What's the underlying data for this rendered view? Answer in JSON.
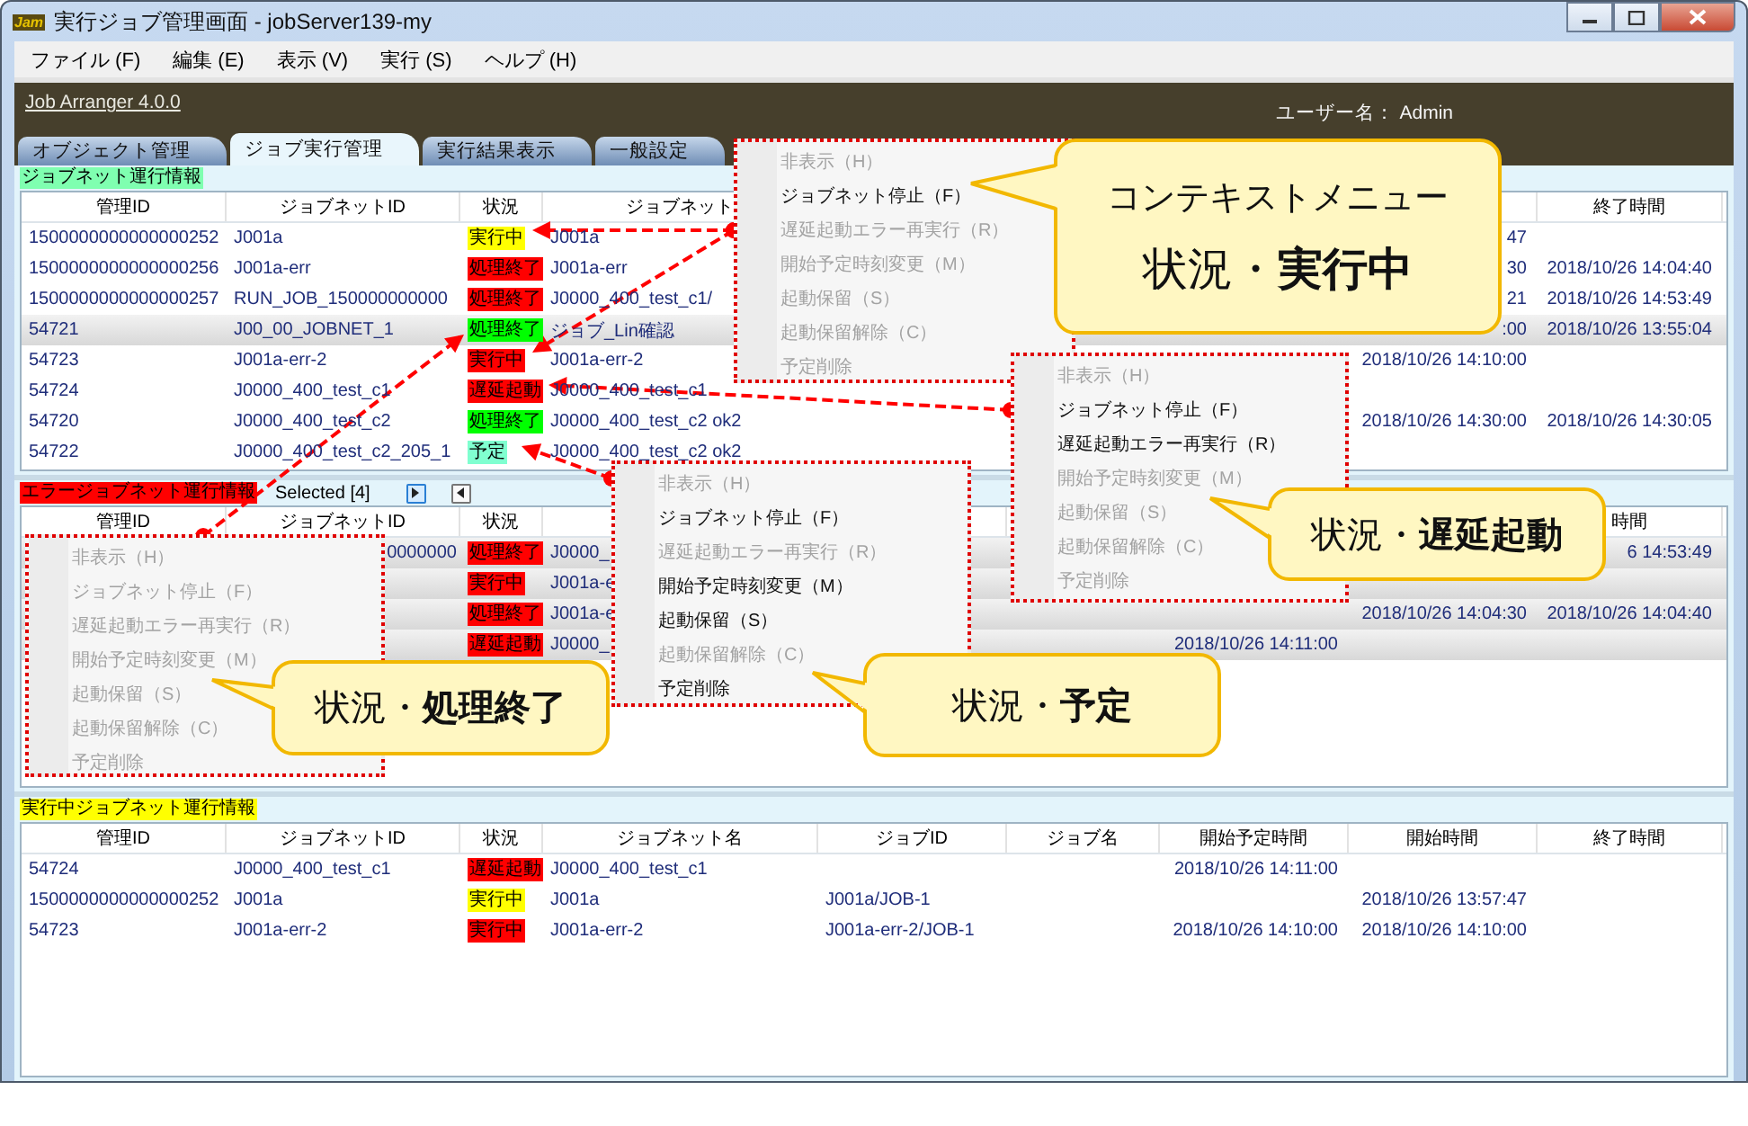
{
  "window": {
    "title": "実行ジョブ管理画面 - jobServer139-my",
    "app_icon": "Jam"
  },
  "menu_bar": [
    "ファイル (F)",
    "編集 (E)",
    "表示 (V)",
    "実行 (S)",
    "ヘルプ (H)"
  ],
  "header": {
    "product": "Job Arranger 4.0.0",
    "user": "ユーザー名： Admin"
  },
  "tabs": [
    {
      "label": "オブジェクト管理",
      "selected": false
    },
    {
      "label": "ジョブ実行管理",
      "selected": true
    },
    {
      "label": "実行結果表示",
      "selected": false
    },
    {
      "label": "一般設定",
      "selected": false
    }
  ],
  "running_panel": {
    "title": "ジョブネット運行情報",
    "table": {
      "columns": {
        "id": "管理ID",
        "jobnet_id": "ジョブネットID",
        "status": "状況",
        "jobnet_name": "ジョブネット",
        "end": "終了時間"
      },
      "rows": [
        {
          "id": "1500000000000000252",
          "jobnet_id": "J001a",
          "status": "実行中",
          "color": "#ffff00",
          "jobnet_name": "J001a",
          "start": "47",
          "selected": false
        },
        {
          "id": "1500000000000000256",
          "jobnet_id": "J001a-err",
          "status": "処理終了",
          "color": "#ff0000",
          "jobnet_name": "J001a-err",
          "start": "30",
          "end": "2018/10/26 14:04:40",
          "selected": false
        },
        {
          "id": "1500000000000000257",
          "jobnet_id": "RUN_JOB_150000000000",
          "status": "処理終了",
          "color": "#ff0000",
          "jobnet_name": "J0000_400_test_c1/",
          "start": "21",
          "end": "2018/10/26 14:53:49",
          "selected": false
        },
        {
          "id": "54721",
          "jobnet_id": "J00_00_JOBNET_1",
          "status": "処理終了",
          "color": "#00ff00",
          "jobnet_name": "ジョブ_Lin確認",
          "start": ":00",
          "end": "2018/10/26 13:55:04",
          "selected": true
        },
        {
          "id": "54723",
          "jobnet_id": "J001a-err-2",
          "status": "実行中",
          "color": "#ff0000",
          "jobnet_name": "J001a-err-2",
          "start": "2018/10/26 14:10:00",
          "selected": false
        },
        {
          "id": "54724",
          "jobnet_id": "J0000_400_test_c1",
          "status": "遅延起動",
          "color": "#ff0000",
          "jobnet_name": "J0000_400_test_c1",
          "selected": false
        },
        {
          "id": "54720",
          "jobnet_id": "J0000_400_test_c2",
          "status": "処理終了",
          "color": "#00ff00",
          "jobnet_name": "J0000_400_test_c2 ok2",
          "start": "2018/10/26 14:30:00",
          "end": "2018/10/26 14:30:05",
          "selected": false
        },
        {
          "id": "54722",
          "jobnet_id": "J0000_400_test_c2_205_1",
          "status": "予定",
          "color": "#80ffd0",
          "jobnet_name": "J0000_400_test_c2 ok2",
          "selected": false
        }
      ]
    }
  },
  "error_panel": {
    "title": "エラージョブネット運行情報",
    "selection": "Selected [4]",
    "table": {
      "columns": {
        "id": "管理ID",
        "jobnet_id": "ジョブネットID",
        "status": "状況",
        "end": "時間"
      },
      "rows": [
        {
          "jobnet_id": "0000000",
          "status": "処理終了",
          "color": "#ff0000",
          "jobnet_name": "J0000_",
          "end": "6 14:53:49",
          "selected": true
        },
        {
          "status": "実行中",
          "color": "#ff0000",
          "jobnet_name": "J001a-e",
          "selected": true
        },
        {
          "status": "処理終了",
          "color": "#ff0000",
          "jobnet_name": "J001a-e",
          "start": "2018/10/26 14:04:30",
          "end": "2018/10/26 14:04:40",
          "selected": true
        },
        {
          "status": "遅延起動",
          "color": "#ff0000",
          "jobnet_name": "J0000_",
          "scheduled_start": "2018/10/26 14:11:00",
          "selected": true
        }
      ]
    }
  },
  "active_panel": {
    "title": "実行中ジョブネット運行情報",
    "table": {
      "columns": {
        "id": "管理ID",
        "jobnet_id": "ジョブネットID",
        "status": "状況",
        "jobnet_name": "ジョブネット名",
        "job_id": "ジョブID",
        "job_name": "ジョブ名",
        "scheduled_start": "開始予定時間",
        "start": "開始時間",
        "end": "終了時間"
      },
      "rows": [
        {
          "id": "54724",
          "jobnet_id": "J0000_400_test_c1",
          "status": "遅延起動",
          "color": "#ff0000",
          "jobnet_name": "J0000_400_test_c1",
          "scheduled_start": "2018/10/26 14:11:00",
          "selected": false
        },
        {
          "id": "1500000000000000252",
          "jobnet_id": "J001a",
          "status": "実行中",
          "color": "#ffff00",
          "jobnet_name": "J001a",
          "job_id": "J001a/JOB-1",
          "start": "2018/10/26 13:57:47",
          "selected": false
        },
        {
          "id": "54723",
          "jobnet_id": "J001a-err-2",
          "status": "実行中",
          "color": "#ff0000",
          "jobnet_name": "J001a-err-2",
          "job_id": "J001a-err-2/JOB-1",
          "scheduled_start": "2018/10/26 14:10:00",
          "start": "2018/10/26 14:10:00",
          "selected": false
        }
      ]
    }
  },
  "context_menus": [
    {
      "items": [
        {
          "label": "非表示（H）",
          "enabled": false
        },
        {
          "label": "ジョブネット停止（F）",
          "enabled": true
        },
        {
          "label": "遅延起動エラー再実行（R）",
          "enabled": false
        },
        {
          "label": "開始予定時刻変更（M）",
          "enabled": false
        },
        {
          "label": "起動保留（S）",
          "enabled": false
        },
        {
          "label": "起動保留解除（C）",
          "enabled": false
        },
        {
          "label": "予定削除",
          "enabled": false
        }
      ]
    },
    {
      "items": [
        {
          "label": "非表示（H）",
          "enabled": false
        },
        {
          "label": "ジョブネット停止（F）",
          "enabled": true
        },
        {
          "label": "遅延起動エラー再実行（R）",
          "enabled": true
        },
        {
          "label": "開始予定時刻変更（M）",
          "enabled": false
        },
        {
          "label": "起動保留（S）",
          "enabled": false
        },
        {
          "label": "起動保留解除（C）",
          "enabled": false
        },
        {
          "label": "予定削除",
          "enabled": false
        }
      ]
    },
    {
      "items": [
        {
          "label": "非表示（H）",
          "enabled": false
        },
        {
          "label": "ジョブネット停止（F）",
          "enabled": false
        },
        {
          "label": "遅延起動エラー再実行（R）",
          "enabled": false
        },
        {
          "label": "開始予定時刻変更（M）",
          "enabled": false
        },
        {
          "label": "起動保留（S）",
          "enabled": false
        },
        {
          "label": "起動保留解除（C）",
          "enabled": false
        },
        {
          "label": "予定削除",
          "enabled": false
        }
      ]
    },
    {
      "items": [
        {
          "label": "非表示（H）",
          "enabled": false
        },
        {
          "label": "ジョブネット停止（F）",
          "enabled": true
        },
        {
          "label": "遅延起動エラー再実行（R）",
          "enabled": false
        },
        {
          "label": "開始予定時刻変更（M）",
          "enabled": true
        },
        {
          "label": "起動保留（S）",
          "enabled": true
        },
        {
          "label": "起動保留解除（C）",
          "enabled": false
        },
        {
          "label": "予定削除",
          "enabled": true
        }
      ]
    }
  ],
  "callouts": [
    {
      "lines": [
        "コンテキストメニュー",
        "状況・**実行中**"
      ]
    },
    {
      "lines": [
        "状況・**遅延起動**"
      ]
    },
    {
      "lines": [
        "状況・**処理終了**"
      ]
    },
    {
      "lines": [
        "状況・**予定**"
      ]
    }
  ]
}
